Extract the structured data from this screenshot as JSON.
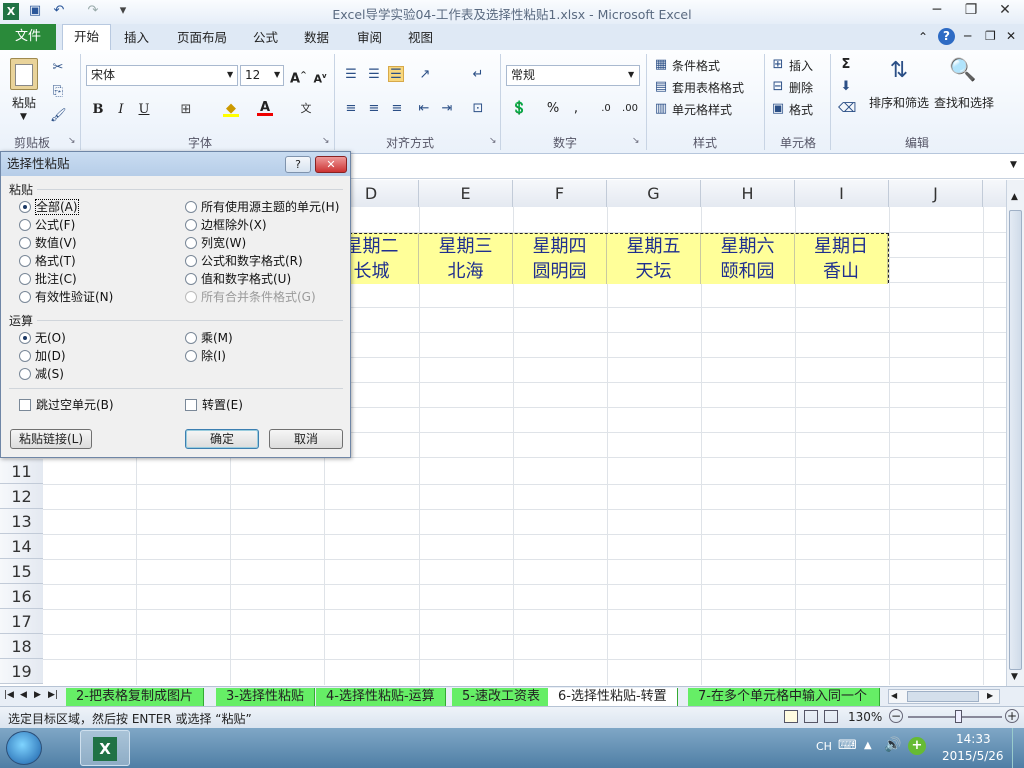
{
  "window": {
    "title": "Excel导学实验04-工作表及选择性粘贴1.xlsx - Microsoft Excel"
  },
  "tabs": {
    "file": "文件",
    "home": "开始",
    "insert": "插入",
    "layout": "页面布局",
    "formulas": "公式",
    "data": "数据",
    "review": "审阅",
    "view": "视图"
  },
  "ribbon": {
    "paste": "粘贴",
    "font_name": "宋体",
    "font_size": "12",
    "number_format": "常规",
    "cond_format": "条件格式",
    "table_format": "套用表格格式",
    "cell_style": "单元格样式",
    "insert": "插入",
    "delete": "删除",
    "format": "格式",
    "sort_filter": "排序和筛选",
    "find_select": "查找和选择",
    "groups": {
      "clipboard": "剪贴板",
      "font": "字体",
      "align": "对齐方式",
      "number": "数字",
      "styles": "样式",
      "cells": "单元格",
      "edit": "编辑"
    }
  },
  "columns": [
    "D",
    "E",
    "F",
    "G",
    "H",
    "I",
    "J"
  ],
  "rows": [
    "11",
    "12",
    "13",
    "14",
    "15",
    "16",
    "17",
    "18",
    "19"
  ],
  "cells": {
    "row1": [
      "星期二",
      "星期三",
      "星期四",
      "星期五",
      "星期六",
      "星期日"
    ],
    "row2": [
      "长城",
      "北海",
      "圆明园",
      "天坛",
      "颐和园",
      "香山"
    ]
  },
  "dialog": {
    "title": "选择性粘贴",
    "paste_group": "粘贴",
    "paste_left": [
      "全部(A)",
      "公式(F)",
      "数值(V)",
      "格式(T)",
      "批注(C)",
      "有效性验证(N)"
    ],
    "paste_right": [
      "所有使用源主题的单元(H)",
      "边框除外(X)",
      "列宽(W)",
      "公式和数字格式(R)",
      "值和数字格式(U)",
      "所有合并条件格式(G)"
    ],
    "op_group": "运算",
    "op_left": [
      "无(O)",
      "加(D)",
      "减(S)"
    ],
    "op_right": [
      "乘(M)",
      "除(I)"
    ],
    "skip_blanks": "跳过空单元(B)",
    "transpose": "转置(E)",
    "paste_link": "粘贴链接(L)",
    "ok": "确定",
    "cancel": "取消",
    "help": "?"
  },
  "sheets": [
    "2-把表格复制成图片",
    "3-选择性粘贴",
    "4-选择性粘贴-运算",
    "5-速改工资表",
    "6-选择性粘贴-转置",
    "7-在多个单元格中输入同一个"
  ],
  "status": {
    "text": "选定目标区域，然后按 ENTER 或选择 “粘贴”",
    "zoom": "130%"
  },
  "taskbar": {
    "lang": "CH",
    "time": "14:33",
    "date": "2015/5/26"
  }
}
